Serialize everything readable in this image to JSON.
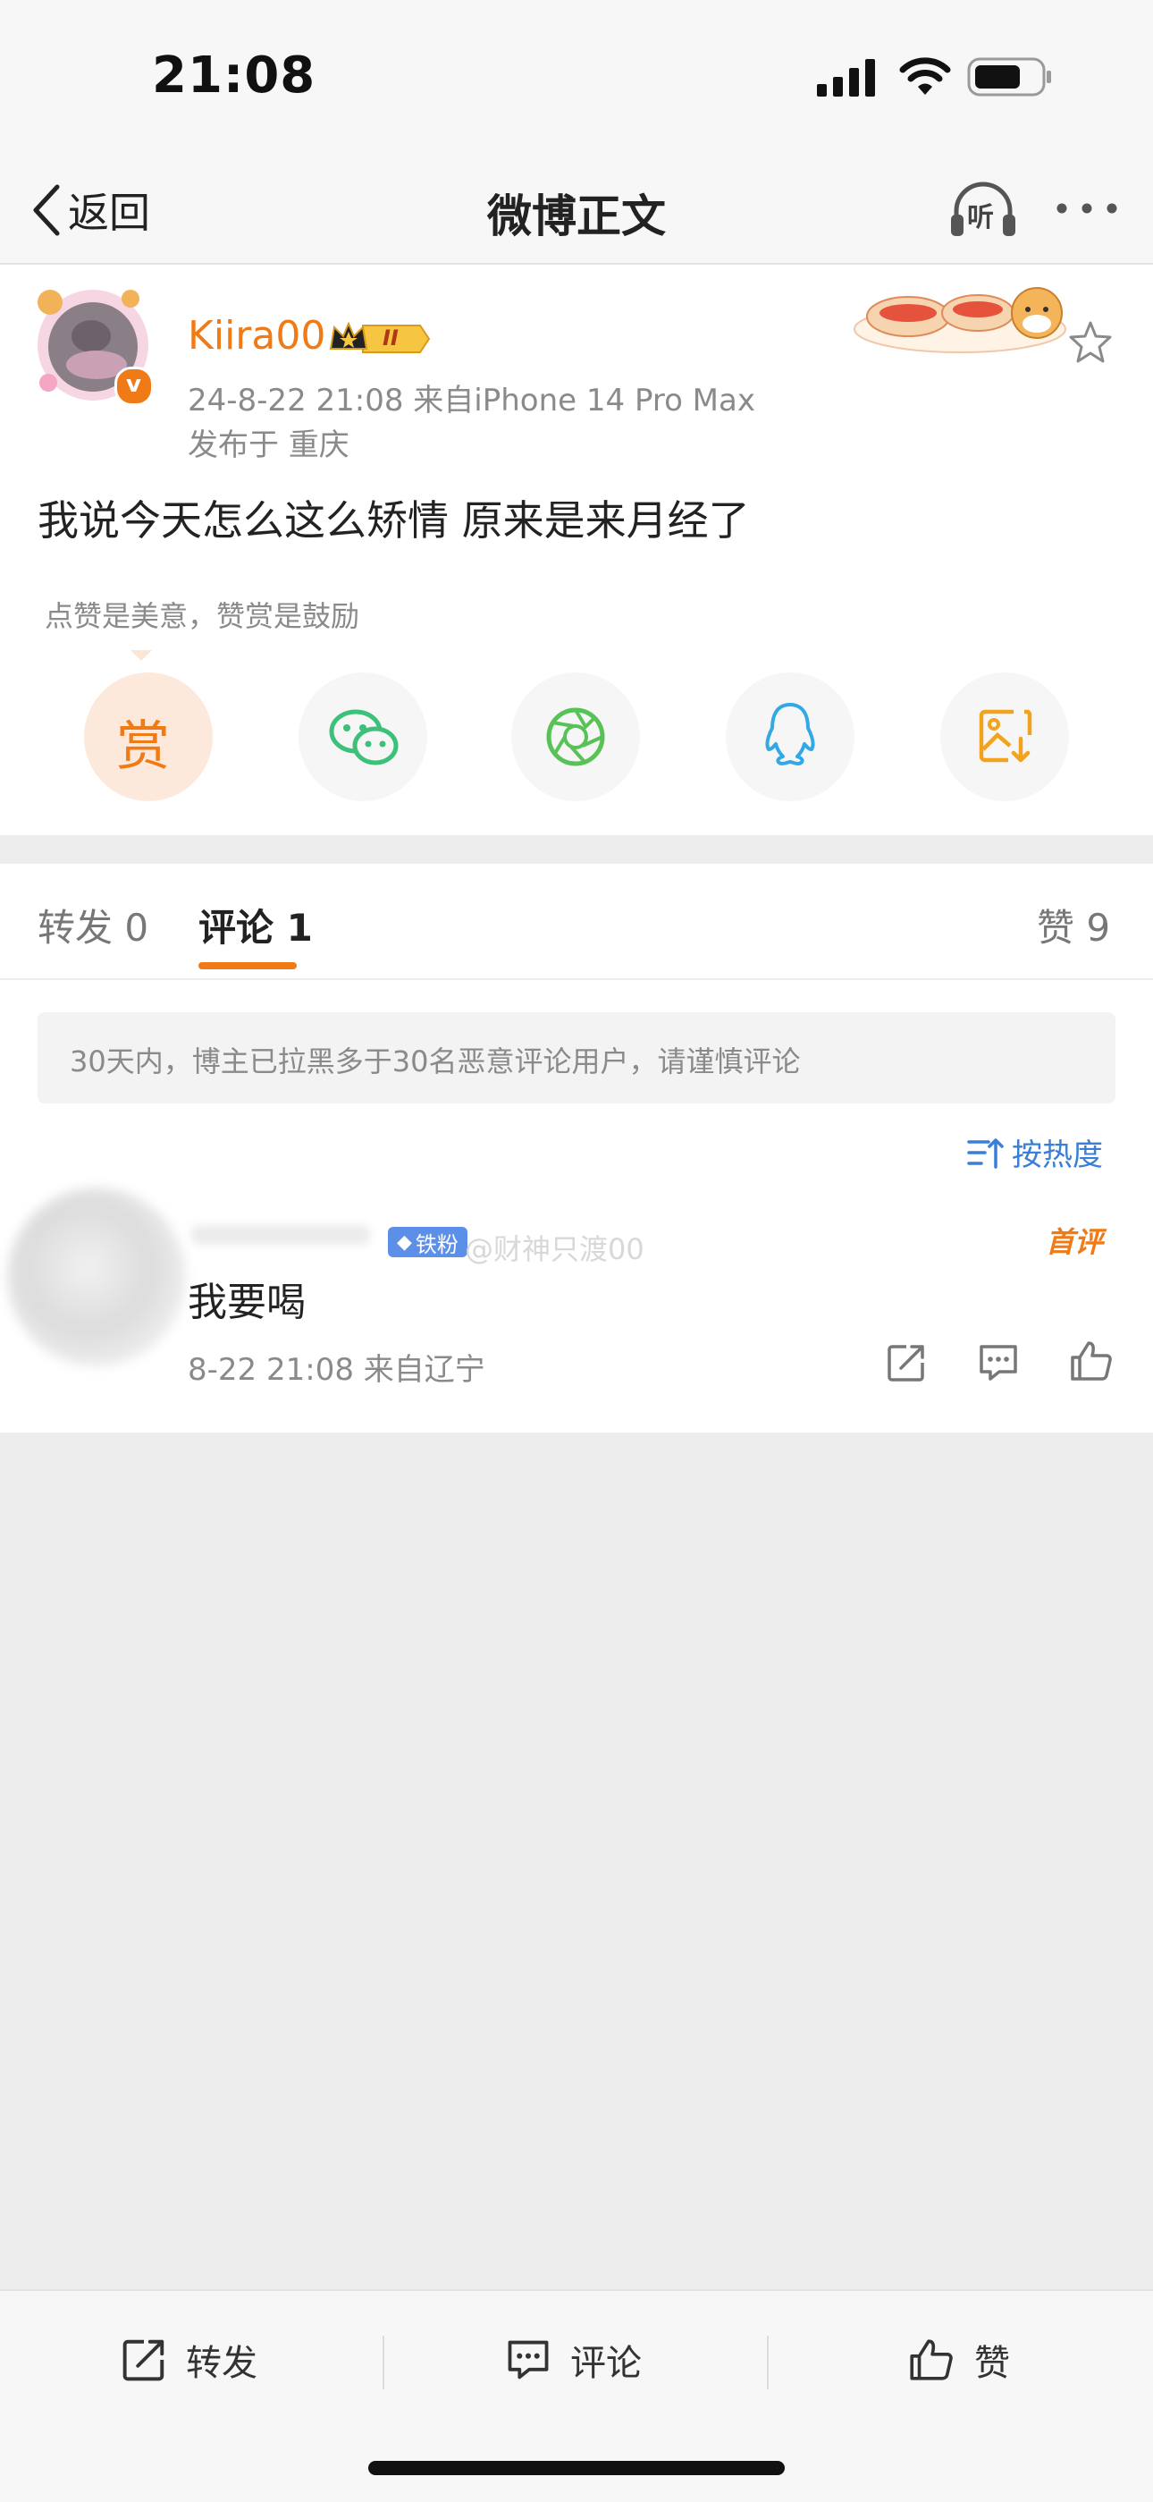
{
  "status_bar": {
    "time": "21:08"
  },
  "nav": {
    "back_label": "返回",
    "title": "微博正文",
    "listen_label": "听"
  },
  "post": {
    "author": "Kiira00",
    "level_badge": "II",
    "meta_time_source": "24-8-22 21:08  来自iPhone 14 Pro Max",
    "meta_location": "发布于 重庆",
    "text": "我说今天怎么这么矫情 原来是来月经了",
    "reward_hint": "点赞是美意，赞赏是鼓励",
    "reward_label": "赏"
  },
  "tabs": {
    "repost": "转发 0",
    "comment": "评论 1",
    "like": "赞 9"
  },
  "comments": {
    "notice": "30天内，博主已拉黑多于30名恶意评论用户，请谨慎评论",
    "sort_label": "按热度",
    "items": [
      {
        "fan_badge": "铁粉",
        "watermark": "@财神只渡00",
        "first_badge": "首评",
        "text": "我要喝",
        "meta": "8-22 21:08  来自辽宁"
      }
    ]
  },
  "bottom_bar": {
    "repost": "转发",
    "comment": "评论",
    "like": "赞"
  },
  "colors": {
    "accent": "#f07b16",
    "link": "#3a7fd6",
    "wechat": "#3cc07a",
    "moments": "#58c257",
    "qq": "#32a9e6",
    "save": "#f2a31e"
  }
}
